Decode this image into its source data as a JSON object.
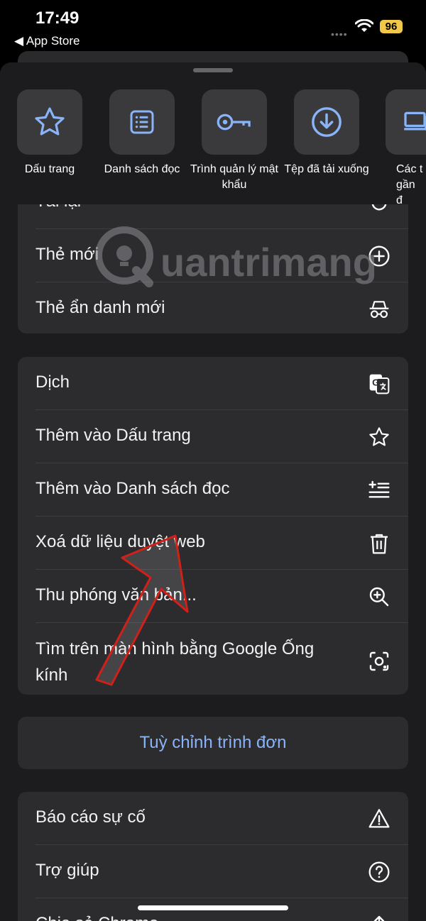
{
  "status_bar": {
    "time": "17:49",
    "back_app": "App Store",
    "battery": "96"
  },
  "quick_actions": [
    {
      "label": "Dấu trang",
      "icon": "star-icon"
    },
    {
      "label": "Danh sách đọc",
      "icon": "reading-list-icon"
    },
    {
      "label": "Trình quản lý mật khẩu",
      "icon": "key-icon"
    },
    {
      "label": "Tệp đã tải xuống",
      "icon": "download-icon"
    },
    {
      "label": "Các t gần đ",
      "icon": "devices-icon"
    }
  ],
  "group1": {
    "partial_label": "Tải lại",
    "items": [
      {
        "label": "Thẻ mới",
        "icon": "plus-circle-icon"
      },
      {
        "label": "Thẻ ẩn danh mới",
        "icon": "incognito-icon"
      }
    ]
  },
  "group2": {
    "items": [
      {
        "label": "Dịch",
        "icon": "translate-icon"
      },
      {
        "label": "Thêm vào Dấu trang",
        "icon": "star-outline-icon"
      },
      {
        "label": "Thêm vào Danh sách đọc",
        "icon": "add-list-icon"
      },
      {
        "label": "Xoá dữ liệu duyệt web",
        "icon": "trash-icon"
      },
      {
        "label": "Thu phóng văn bản...",
        "icon": "zoom-in-icon"
      },
      {
        "label": "Tìm trên màn hình bằng Google Ống kính",
        "icon": "lens-icon"
      }
    ]
  },
  "customize": {
    "label": "Tuỳ chỉnh trình đơn"
  },
  "group3": {
    "items": [
      {
        "label": "Báo cáo sự cố",
        "icon": "warning-icon"
      },
      {
        "label": "Trợ giúp",
        "icon": "help-icon"
      },
      {
        "label": "Chia sẻ Chrome",
        "icon": "share-icon"
      }
    ]
  },
  "watermark": {
    "text": "uantrimang"
  },
  "colors": {
    "accent": "#8ab4f8",
    "sheet": "#1c1c1e",
    "card": "#2c2c2e",
    "annotation": "#d0201a"
  }
}
